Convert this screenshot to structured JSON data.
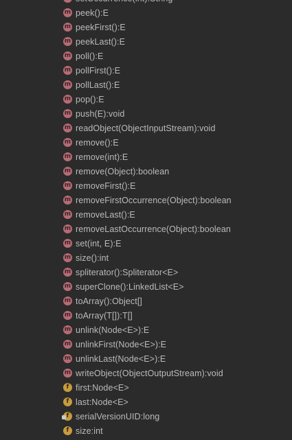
{
  "members": [
    {
      "label": "set(int, E):E (partial)",
      "kind": "method",
      "text": "setOccurrence(int):String"
    },
    {
      "kind": "method",
      "text": "peek():E"
    },
    {
      "kind": "method",
      "text": "peekFirst():E"
    },
    {
      "kind": "method",
      "text": "peekLast():E"
    },
    {
      "kind": "method",
      "text": "poll():E"
    },
    {
      "kind": "method",
      "text": "pollFirst():E"
    },
    {
      "kind": "method",
      "text": "pollLast():E"
    },
    {
      "kind": "method",
      "text": "pop():E"
    },
    {
      "kind": "method",
      "text": "push(E):void"
    },
    {
      "kind": "method",
      "text": "readObject(ObjectInputStream):void"
    },
    {
      "kind": "method",
      "text": "remove():E"
    },
    {
      "kind": "method",
      "text": "remove(int):E"
    },
    {
      "kind": "method",
      "text": "remove(Object):boolean"
    },
    {
      "kind": "method",
      "text": "removeFirst():E"
    },
    {
      "kind": "method",
      "text": "removeFirstOccurrence(Object):boolean"
    },
    {
      "kind": "method",
      "text": "removeLast():E"
    },
    {
      "kind": "method",
      "text": "removeLastOccurrence(Object):boolean"
    },
    {
      "kind": "method",
      "text": "set(int, E):E"
    },
    {
      "kind": "method",
      "text": "size():int"
    },
    {
      "kind": "method",
      "text": "spliterator():Spliterator<E>"
    },
    {
      "kind": "method",
      "text": "superClone():LinkedList<E>"
    },
    {
      "kind": "method",
      "text": "toArray():Object[]"
    },
    {
      "kind": "method",
      "text": "toArray(T[]):T[]"
    },
    {
      "kind": "method",
      "text": "unlink(Node<E>):E"
    },
    {
      "kind": "method",
      "text": "unlinkFirst(Node<E>):E"
    },
    {
      "kind": "method",
      "text": "unlinkLast(Node<E>):E"
    },
    {
      "kind": "method",
      "text": "writeObject(ObjectOutputStream):void"
    },
    {
      "kind": "field",
      "text": "first:Node<E>"
    },
    {
      "kind": "field",
      "text": "last:Node<E>"
    },
    {
      "kind": "static-field",
      "text": "serialVersionUID:long"
    },
    {
      "kind": "field",
      "text": "size:int"
    }
  ],
  "icon_letters": {
    "method": "m",
    "field": "f"
  },
  "colors": {
    "background": "#2b2b2b",
    "text": "#bbbbbb",
    "method_icon": "#b86b74",
    "field_icon": "#c79b3e"
  }
}
